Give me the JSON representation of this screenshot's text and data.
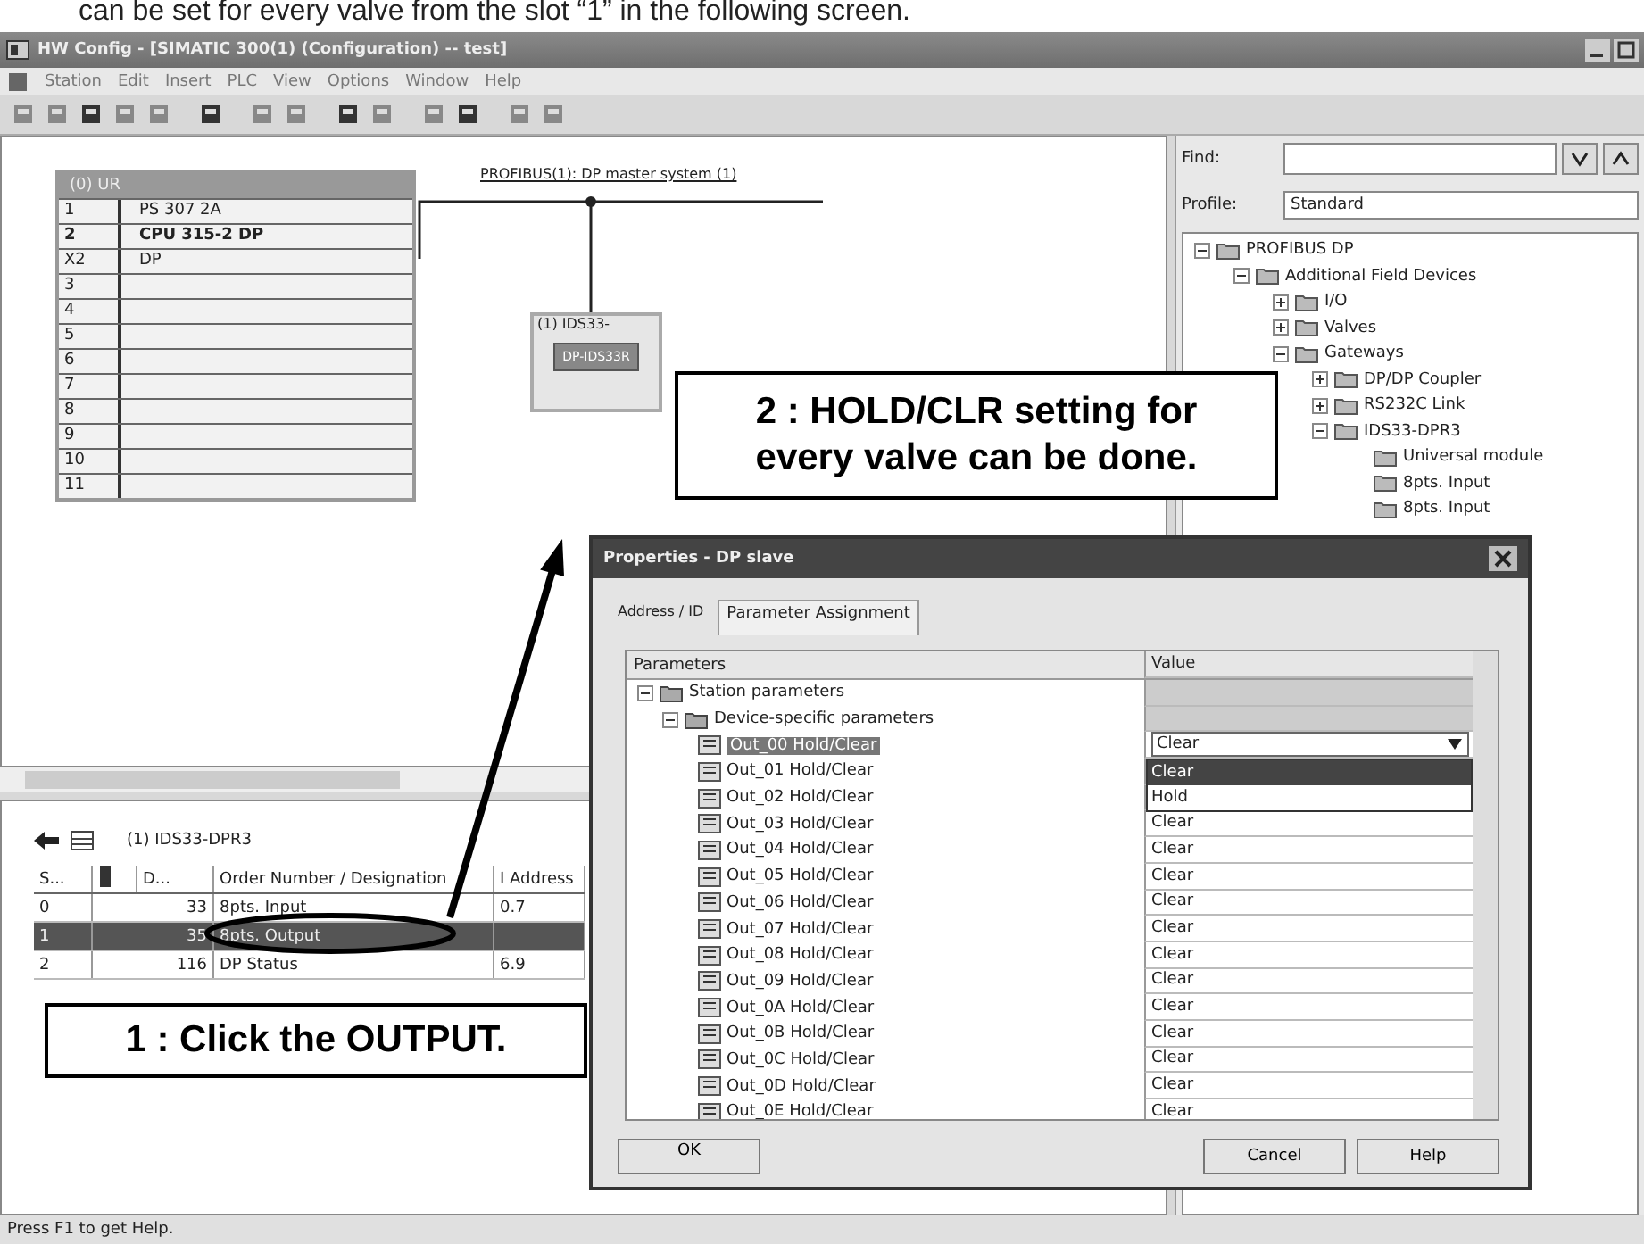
{
  "caption": "can be set for every valve from the slot “1” in the following screen.",
  "window": {
    "title": "HW Config - [SIMATIC 300(1) (Configuration) -- test]"
  },
  "menu": [
    "Station",
    "Edit",
    "Insert",
    "PLC",
    "View",
    "Options",
    "Window",
    "Help"
  ],
  "rack": {
    "title": "(0) UR",
    "slots": [
      {
        "slot": "1",
        "module": "PS 307 2A",
        "bold": false
      },
      {
        "slot": "2",
        "module": "CPU 315-2 DP",
        "bold": true
      },
      {
        "slot": "X2",
        "module": "DP",
        "bold": false
      },
      {
        "slot": "3",
        "bold": false
      },
      {
        "slot": "4",
        "bold": false
      },
      {
        "slot": "5",
        "bold": false
      },
      {
        "slot": "6",
        "bold": false
      },
      {
        "slot": "7",
        "bold": false
      },
      {
        "slot": "8",
        "bold": false
      },
      {
        "slot": "9",
        "bold": false
      },
      {
        "slot": "10",
        "bold": false
      },
      {
        "slot": "11",
        "bold": false
      }
    ]
  },
  "bus": {
    "label": "PROFIBUS(1): DP master system (1)"
  },
  "slave": {
    "label": "(1) IDS33-",
    "module": "DP-IDS33R"
  },
  "catalog": {
    "find_label": "Find:",
    "profile_label": "Profile:",
    "profile": "Standard",
    "tree": [
      {
        "label": "PROFIBUS DP",
        "expanded": true,
        "children": [
          {
            "label": "Additional Field Devices",
            "expanded": true,
            "children": [
              {
                "label": "I/O",
                "expanded": false
              },
              {
                "label": "Valves",
                "expanded": false
              },
              {
                "label": "Gateways",
                "expanded": true,
                "children": [
                  {
                    "label": "DP/DP Coupler",
                    "expanded": false
                  },
                  {
                    "label": "RS232C Link",
                    "expanded": false
                  },
                  {
                    "label": "IDS33-DPR3",
                    "expanded": true,
                    "children": [
                      {
                        "label": "Universal module"
                      },
                      {
                        "label": "8pts. Input"
                      },
                      {
                        "label": "8pts. Input"
                      }
                    ]
                  }
                ]
              }
            ]
          }
        ]
      }
    ]
  },
  "detail": {
    "title": "(1) IDS33-DPR3",
    "columns": [
      {
        "kind": "text",
        "label": "S..."
      },
      {
        "kind": "icon"
      },
      {
        "kind": "text",
        "label": "D..."
      },
      {
        "kind": "text",
        "label": "Order Number / Designation"
      },
      {
        "kind": "text",
        "label": "I Address"
      }
    ],
    "rows": [
      {
        "slot": "0",
        "dp_id": "33",
        "designation": "8pts. Input",
        "i_address": "0.7",
        "selected": false
      },
      {
        "slot": "1",
        "dp_id": "35",
        "designation": "8pts. Output",
        "selected": true
      },
      {
        "slot": "2",
        "dp_id": "116",
        "designation": "DP Status",
        "i_address": "6.9",
        "selected": false
      }
    ]
  },
  "dialog": {
    "title": "Properties - DP slave",
    "tabs": [
      {
        "label": "Address / ID",
        "selected": false
      },
      {
        "label": "Parameter Assignment",
        "selected": true
      }
    ],
    "columns": [
      "Parameters",
      "Value"
    ],
    "groups": [
      "Station parameters",
      "Device-specific parameters"
    ],
    "dropdown": {
      "value": "Clear",
      "open": true,
      "options": [
        {
          "label": "Clear",
          "selected": true
        },
        {
          "label": "Hold",
          "selected": false
        }
      ]
    },
    "params": [
      {
        "label": "Out_00 Hold/Clear",
        "selected": true
      },
      {
        "label": "Out_01 Hold/Clear",
        "selected": false
      },
      {
        "label": "Out_02 Hold/Clear",
        "selected": false
      },
      {
        "label": "Out_03 Hold/Clear",
        "value": "Clear",
        "selected": false
      },
      {
        "label": "Out_04 Hold/Clear",
        "value": "Clear",
        "selected": false
      },
      {
        "label": "Out_05 Hold/Clear",
        "value": "Clear",
        "selected": false
      },
      {
        "label": "Out_06 Hold/Clear",
        "value": "Clear",
        "selected": false
      },
      {
        "label": "Out_07 Hold/Clear",
        "value": "Clear",
        "selected": false
      },
      {
        "label": "Out_08 Hold/Clear",
        "value": "Clear",
        "selected": false
      },
      {
        "label": "Out_09 Hold/Clear",
        "value": "Clear",
        "selected": false
      },
      {
        "label": "Out_0A Hold/Clear",
        "value": "Clear",
        "selected": false
      },
      {
        "label": "Out_0B Hold/Clear",
        "value": "Clear",
        "selected": false
      },
      {
        "label": "Out_0C Hold/Clear",
        "value": "Clear",
        "selected": false
      },
      {
        "label": "Out_0D Hold/Clear",
        "value": "Clear",
        "selected": false
      },
      {
        "label": "Out_0E Hold/Clear",
        "value": "Clear",
        "selected": false
      }
    ],
    "buttons": [
      {
        "label": "OK",
        "kind": "left"
      },
      {
        "label": "Cancel",
        "kind": "right"
      },
      {
        "label": "Help",
        "kind": "right"
      }
    ]
  },
  "status_bar": "Press F1 to get Help.",
  "callouts": [
    {
      "kind": "dialog",
      "text": "2 : HOLD/CLR setting for\nevery valve can be done."
    },
    {
      "kind": "row",
      "text": "1 : Click the OUTPUT."
    }
  ]
}
